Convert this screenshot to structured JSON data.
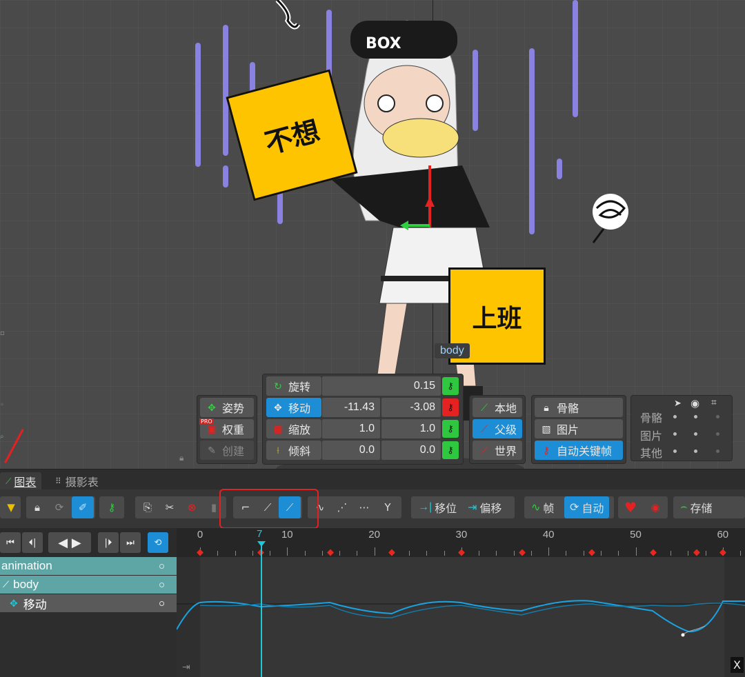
{
  "viewport": {
    "signs": {
      "left": "不想",
      "right": "上班"
    },
    "cap_text": "BOX",
    "bone_label": "body"
  },
  "transform": {
    "rows": [
      {
        "label": "旋转",
        "icon": "rotate-icon",
        "v1": "",
        "v2": "0.15",
        "key": "green"
      },
      {
        "label": "移动",
        "icon": "move-icon",
        "v1": "-11.43",
        "v2": "-3.08",
        "key": "red"
      },
      {
        "label": "缩放",
        "icon": "scale-icon",
        "v1": "1.0",
        "v2": "1.0",
        "key": "green"
      },
      {
        "label": "倾斜",
        "icon": "shear-icon",
        "v1": "0.0",
        "v2": "0.0",
        "key": "green"
      }
    ],
    "left_buttons": [
      "姿势",
      "权重",
      "创建"
    ],
    "pro_badge": "PRO",
    "axes": [
      "本地",
      "父级",
      "世界"
    ],
    "right_buttons": [
      "骨骼",
      "图片",
      "自动关键帧"
    ],
    "visibility": {
      "rows": [
        "骨骼",
        "图片",
        "其他"
      ]
    }
  },
  "tabs": {
    "graph": "图表",
    "dopesheet": "摄影表"
  },
  "toolbar": {
    "offset1": "移位",
    "offset2": "偏移",
    "frames": "帧",
    "auto": "自动",
    "store": "存储"
  },
  "timeline": {
    "current_frame": "7",
    "ticks": [
      "0",
      "10",
      "20",
      "30",
      "40",
      "50",
      "60"
    ],
    "keyframes": [
      0,
      7,
      15,
      22,
      30,
      37,
      45,
      52,
      57,
      60
    ]
  },
  "tree": {
    "items": [
      {
        "label": "animation"
      },
      {
        "label": "body"
      },
      {
        "label": "移动"
      }
    ]
  },
  "corner_label": "X",
  "colors": {
    "accent": "#1d8ed6",
    "keyframe": "#e8281e",
    "playhead": "#1ec8d8",
    "curve": "#1aa3e0"
  }
}
